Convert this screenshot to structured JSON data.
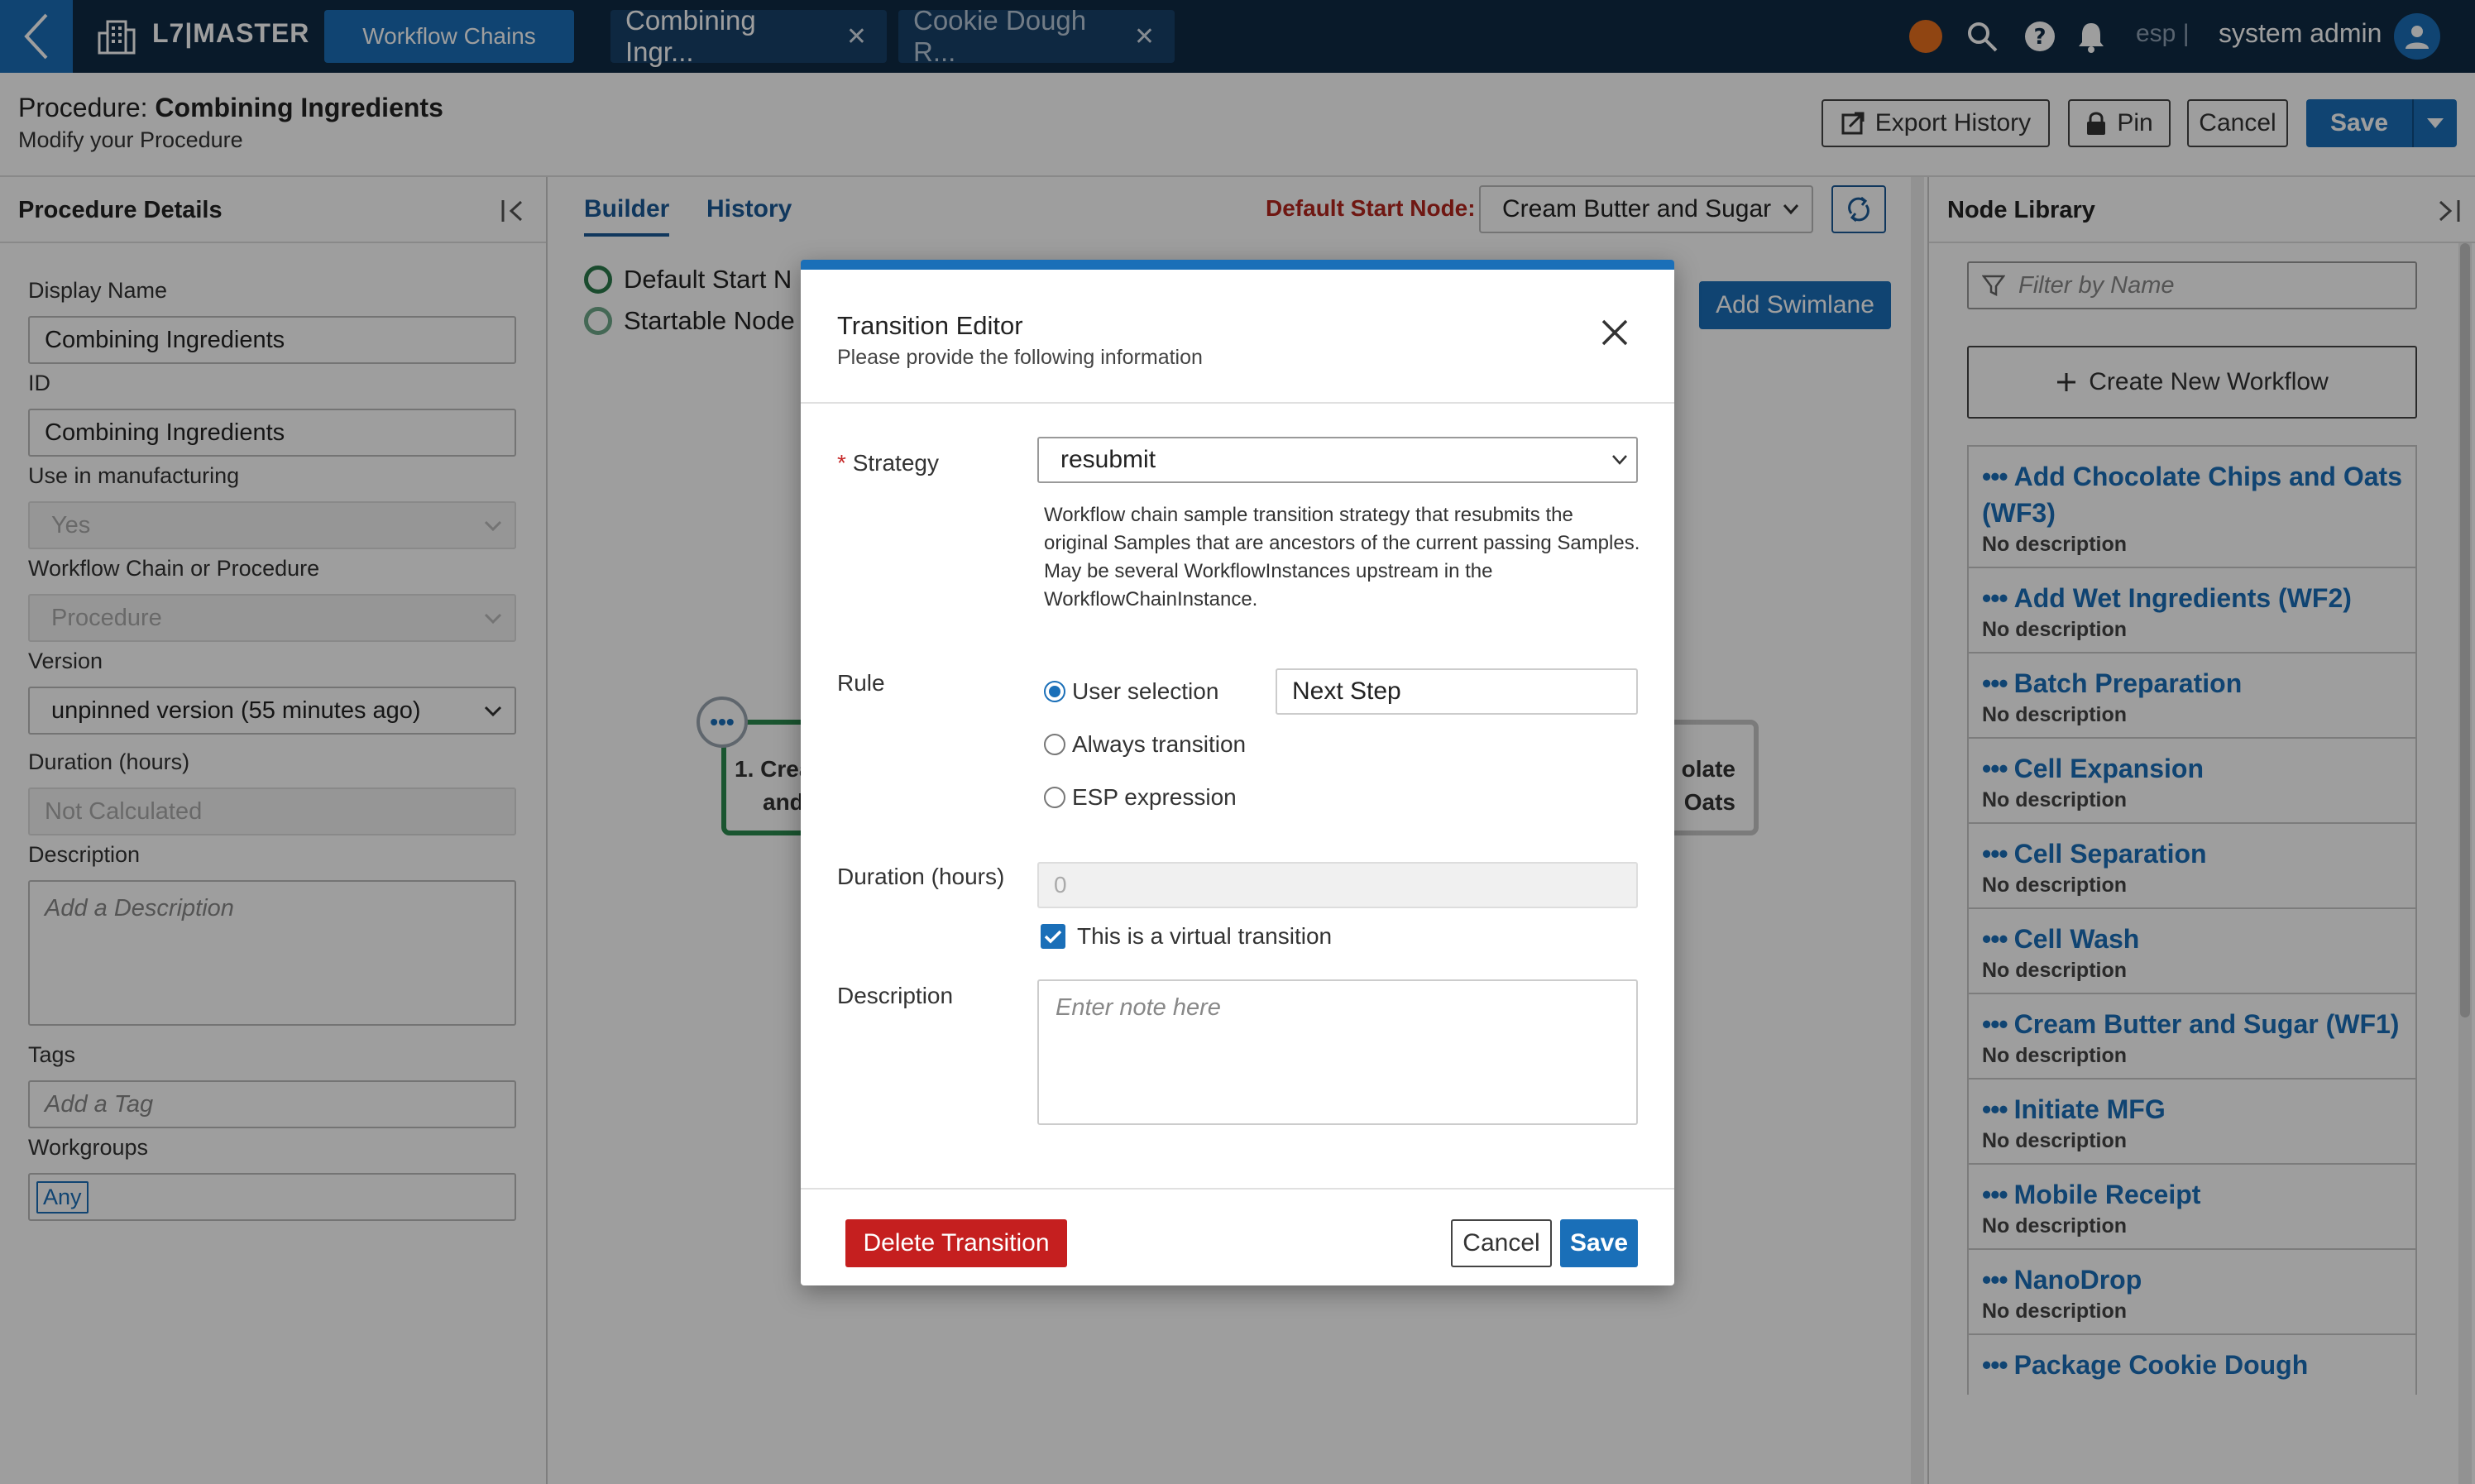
{
  "topbar": {
    "app_name": "L7|MASTER",
    "nav_button": "Workflow Chains",
    "tabs": [
      {
        "label": "Combining Ingr..."
      },
      {
        "label": "Cookie Dough R..."
      }
    ],
    "tenant": "esp |",
    "user_name": "system admin",
    "status_color": "#e8701e"
  },
  "header": {
    "title_prefix": "Procedure:",
    "title_name": "Combining Ingredients",
    "subtitle": "Modify your Procedure",
    "export_label": "Export History",
    "pin_label": "Pin",
    "cancel_label": "Cancel",
    "save_label": "Save"
  },
  "left_panel": {
    "title": "Procedure Details",
    "display_name_label": "Display Name",
    "display_name_value": "Combining Ingredients",
    "id_label": "ID",
    "id_value": "Combining Ingredients",
    "manufacturing_label": "Use in manufacturing",
    "manufacturing_value": "Yes",
    "chain_label": "Workflow Chain or Procedure",
    "chain_value": "Procedure",
    "version_label": "Version",
    "version_value": "unpinned version (55 minutes ago)",
    "duration_label": "Duration (hours)",
    "duration_value": "Not Calculated",
    "description_label": "Description",
    "description_placeholder": "Add a Description",
    "tags_label": "Tags",
    "tags_placeholder": "Add a Tag",
    "workgroups_label": "Workgroups",
    "workgroups_value": "Any"
  },
  "canvas": {
    "tab_builder": "Builder",
    "tab_history": "History",
    "default_start_label": "Default Start Node:",
    "default_start_value": "Cream Butter and Sugar",
    "legend_default": "Default Start N",
    "legend_startable": "Startable Node",
    "add_swimlane": "Add Swimlane",
    "node1_line1": "1. Crea",
    "node1_line2": "and",
    "node2_line1": "olate",
    "node2_line2": "Oats",
    "node_dots": "•••"
  },
  "right_panel": {
    "title": "Node Library",
    "filter_placeholder": "Filter by Name",
    "create_label": "Create New Workflow",
    "items": [
      {
        "name": "Add Chocolate Chips and Oats (WF3)",
        "desc": "No description"
      },
      {
        "name": "Add Wet Ingredients (WF2)",
        "desc": "No description"
      },
      {
        "name": "Batch Preparation",
        "desc": "No description"
      },
      {
        "name": "Cell Expansion",
        "desc": "No description"
      },
      {
        "name": "Cell Separation",
        "desc": "No description"
      },
      {
        "name": "Cell Wash",
        "desc": "No description"
      },
      {
        "name": "Cream Butter and Sugar (WF1)",
        "desc": "No description"
      },
      {
        "name": "Initiate MFG",
        "desc": "No description"
      },
      {
        "name": "Mobile Receipt",
        "desc": "No description"
      },
      {
        "name": "NanoDrop",
        "desc": "No description"
      },
      {
        "name": "Package Cookie Dough",
        "desc": ""
      }
    ]
  },
  "modal": {
    "title": "Transition Editor",
    "subtitle": "Please provide the following information",
    "required_mark": "*",
    "strategy_label": "Strategy",
    "strategy_value": "resubmit",
    "strategy_help": "Workflow chain sample transition strategy that resubmits the original Samples that are ancestors of the current passing Samples. May be several WorkflowInstances upstream in the WorkflowChainInstance.",
    "rule_label": "Rule",
    "rule_options": [
      {
        "label": "User selection",
        "selected": true
      },
      {
        "label": "Always transition",
        "selected": false
      },
      {
        "label": "ESP expression",
        "selected": false
      }
    ],
    "rule_user_value": "Next Step",
    "duration_label": "Duration (hours)",
    "duration_value": "0",
    "virtual_label": "This is a virtual transition",
    "virtual_checked": true,
    "description_label": "Description",
    "description_placeholder": "Enter note here",
    "delete_label": "Delete Transition",
    "cancel_label": "Cancel",
    "save_label": "Save"
  }
}
